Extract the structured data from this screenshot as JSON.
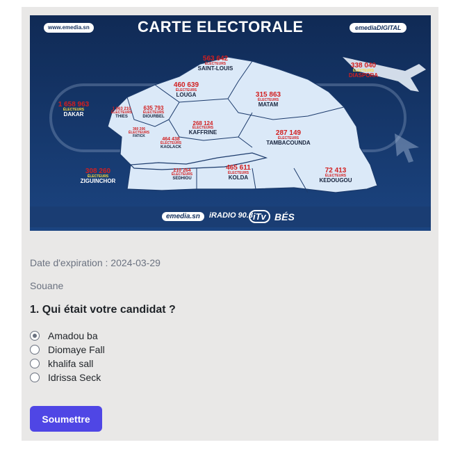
{
  "banner": {
    "site_url": "www.emedia.sn",
    "title": "CARTE ELECTORALE",
    "digital_label": "emediaDIGITAL",
    "footer_brands": [
      "emedia.sn",
      "iRADIO 90.3",
      "iTv",
      "BÉS"
    ],
    "flag_colors": [
      "#12a24a",
      "#f5d21b",
      "#d8202a"
    ],
    "regions": [
      {
        "name": "SAINT-LOUIS",
        "value": "563 642",
        "unit": "ÉLECTEURS"
      },
      {
        "name": "DIASPORA",
        "value": "338 040",
        "unit": "ÉLECTEURS"
      },
      {
        "name": "LOUGA",
        "value": "460 639",
        "unit": "ÉLECTEURS"
      },
      {
        "name": "MATAM",
        "value": "315 863",
        "unit": "ÉLECTEURS"
      },
      {
        "name": "DAKAR",
        "value": "1 658 963",
        "unit": "ÉLECTEURS"
      },
      {
        "name": "THIES",
        "value": "1 063 210",
        "unit": "ÉLECTEURS"
      },
      {
        "name": "DIOURBEL",
        "value": "635 793",
        "unit": "ÉLECTEURS"
      },
      {
        "name": "FATICK",
        "value": "360 206",
        "unit": "ÉLECTEURS"
      },
      {
        "name": "KAFFRINE",
        "value": "268 124",
        "unit": "ÉLECTEURS"
      },
      {
        "name": "KAOLACK",
        "value": "464 438",
        "unit": "ÉLECTEURS"
      },
      {
        "name": "TAMBACOUNDA",
        "value": "287 149",
        "unit": "ÉLECTEURS"
      },
      {
        "name": "ZIGUINCHOR",
        "value": "308 260",
        "unit": "ÉLECTEURS"
      },
      {
        "name": "SEDHIOU",
        "value": "210 264",
        "unit": "ÉLECTEURS"
      },
      {
        "name": "KOLDA",
        "value": "465 611",
        "unit": "ÉLECTEURS"
      },
      {
        "name": "KEDOUGOU",
        "value": "72 413",
        "unit": "ÉLECTEURS"
      }
    ]
  },
  "poll": {
    "expiration": "Date d'expiration : 2024-03-29",
    "author": "Souane",
    "question": "1. Qui était votre candidat ?",
    "options": [
      "Amadou ba",
      "Diomaye Fall",
      "khalifa sall",
      "Idrissa Seck"
    ],
    "selected_index": 0,
    "submit_label": "Soumettre"
  },
  "colors": {
    "accent": "#4f46e5",
    "card_bg": "#e9e8e7",
    "banner_bg": "#13305e",
    "map_fill": "#dbe9f8",
    "label_red": "#d21f1f"
  }
}
